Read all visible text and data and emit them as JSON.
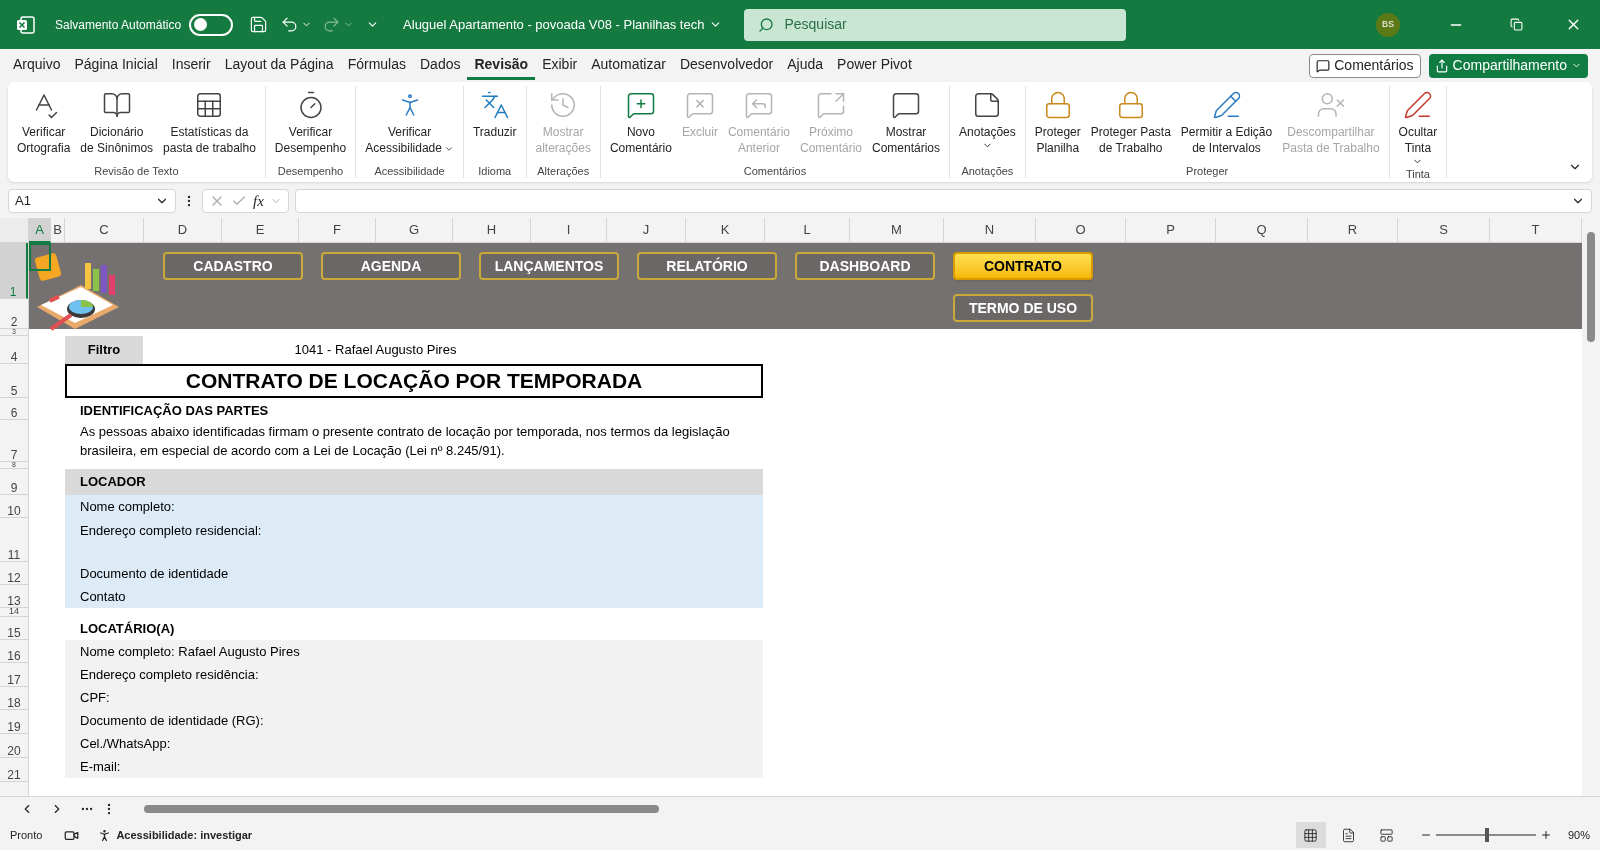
{
  "title_bar": {
    "autosave_label": "Salvamento Automático",
    "autosave_on": false,
    "document_title": "Aluguel Apartamento - povoada V08 - Planilhas tech",
    "search_placeholder": "Pesquisar",
    "user_initials": "BS"
  },
  "menu_tabs": [
    {
      "label": "Arquivo",
      "selected": false
    },
    {
      "label": "Página Inicial",
      "selected": false
    },
    {
      "label": "Inserir",
      "selected": false
    },
    {
      "label": "Layout da Página",
      "selected": false
    },
    {
      "label": "Fórmulas",
      "selected": false
    },
    {
      "label": "Dados",
      "selected": false
    },
    {
      "label": "Revisão",
      "selected": true
    },
    {
      "label": "Exibir",
      "selected": false
    },
    {
      "label": "Automatizar",
      "selected": false
    },
    {
      "label": "Desenvolvedor",
      "selected": false
    },
    {
      "label": "Ajuda",
      "selected": false
    },
    {
      "label": "Power Pivot",
      "selected": false
    }
  ],
  "comments_button": "Comentários",
  "share_button": "Compartilhamento",
  "ribbon_groups": [
    {
      "label": "Revisão de Texto",
      "commands": [
        {
          "label": "Verificar\nOrtografia",
          "disabled": false,
          "dropdown": false
        },
        {
          "label": "Dicionário\nde Sinônimos",
          "disabled": false,
          "dropdown": false
        },
        {
          "label": "Estatísticas da\npasta de trabalho",
          "disabled": false,
          "dropdown": false
        }
      ]
    },
    {
      "label": "Desempenho",
      "commands": [
        {
          "label": "Verificar\nDesempenho",
          "disabled": false,
          "dropdown": false
        }
      ]
    },
    {
      "label": "Acessibilidade",
      "commands": [
        {
          "label": "Verificar\nAcessibilidade",
          "disabled": false,
          "dropdown": true
        }
      ]
    },
    {
      "label": "Idioma",
      "commands": [
        {
          "label": "Traduzir",
          "disabled": false,
          "dropdown": false
        }
      ]
    },
    {
      "label": "Alterações",
      "commands": [
        {
          "label": "Mostrar\nalterações",
          "disabled": true,
          "dropdown": false
        }
      ]
    },
    {
      "label": "Comentários",
      "commands": [
        {
          "label": "Novo\nComentário",
          "disabled": false,
          "dropdown": false
        },
        {
          "label": "Excluir",
          "disabled": true,
          "dropdown": false
        },
        {
          "label": "Comentário\nAnterior",
          "disabled": true,
          "dropdown": false
        },
        {
          "label": "Próximo\nComentário",
          "disabled": true,
          "dropdown": false
        },
        {
          "label": "Mostrar\nComentários",
          "disabled": false,
          "dropdown": false
        }
      ]
    },
    {
      "label": "Anotações",
      "commands": [
        {
          "label": "Anotações",
          "disabled": false,
          "dropdown": true
        }
      ]
    },
    {
      "label": "Proteger",
      "commands": [
        {
          "label": "Proteger\nPlanilha",
          "disabled": false,
          "dropdown": false
        },
        {
          "label": "Proteger Pasta\nde Trabalho",
          "disabled": false,
          "dropdown": false
        },
        {
          "label": "Permitir a Edição\nde Intervalos",
          "disabled": false,
          "dropdown": false
        },
        {
          "label": "Descompartilhar\nPasta de Trabalho",
          "disabled": true,
          "dropdown": false
        }
      ]
    },
    {
      "label": "Tinta",
      "commands": [
        {
          "label": "Ocultar\nTinta",
          "disabled": false,
          "dropdown": true
        }
      ]
    }
  ],
  "formula_bar": {
    "name_box": "A1",
    "function_symbol": "fx"
  },
  "columns": [
    {
      "label": "A",
      "selected": true
    },
    {
      "label": "B",
      "selected": false
    },
    {
      "label": "C",
      "selected": false
    },
    {
      "label": "D",
      "selected": false
    },
    {
      "label": "E",
      "selected": false
    },
    {
      "label": "F",
      "selected": false
    },
    {
      "label": "G",
      "selected": false
    },
    {
      "label": "H",
      "selected": false
    },
    {
      "label": "I",
      "selected": false
    },
    {
      "label": "J",
      "selected": false
    },
    {
      "label": "K",
      "selected": false
    },
    {
      "label": "L",
      "selected": false
    },
    {
      "label": "M",
      "selected": false
    },
    {
      "label": "N",
      "selected": false
    },
    {
      "label": "O",
      "selected": false
    },
    {
      "label": "P",
      "selected": false
    },
    {
      "label": "Q",
      "selected": false
    },
    {
      "label": "R",
      "selected": false
    },
    {
      "label": "S",
      "selected": false
    },
    {
      "label": "T",
      "selected": false
    }
  ],
  "rows": [
    {
      "label": "1",
      "selected": true
    },
    {
      "label": "2",
      "selected": false
    },
    {
      "label": "3",
      "selected": false
    },
    {
      "label": "4",
      "selected": false
    },
    {
      "label": "5",
      "selected": false
    },
    {
      "label": "6",
      "selected": false
    },
    {
      "label": "7",
      "selected": false
    },
    {
      "label": "8",
      "selected": false
    },
    {
      "label": "9",
      "selected": false
    },
    {
      "label": "10",
      "selected": false
    },
    {
      "label": "11",
      "selected": false
    },
    {
      "label": "12",
      "selected": false
    },
    {
      "label": "13",
      "selected": false
    },
    {
      "label": "14",
      "selected": false
    },
    {
      "label": "15",
      "selected": false
    },
    {
      "label": "16",
      "selected": false
    },
    {
      "label": "17",
      "selected": false
    },
    {
      "label": "18",
      "selected": false
    },
    {
      "label": "19",
      "selected": false
    },
    {
      "label": "20",
      "selected": false
    },
    {
      "label": "21",
      "selected": false
    }
  ],
  "nav_buttons": [
    {
      "label": "CADASTRO",
      "selected": false
    },
    {
      "label": "AGENDA",
      "selected": false
    },
    {
      "label": "LANÇAMENTOS",
      "selected": false
    },
    {
      "label": "RELATÓRIO",
      "selected": false
    },
    {
      "label": "DASHBOARD",
      "selected": false
    },
    {
      "label": "CONTRATO",
      "selected": true
    },
    {
      "label": "TERMO DE USO",
      "selected": false
    }
  ],
  "contract": {
    "filter_label": "Filtro",
    "filter_value": "1041 - Rafael Augusto Pires",
    "title": "CONTRATO DE LOCAÇÃO POR TEMPORADA",
    "intro_heading": "IDENTIFICAÇÃO DAS PARTES",
    "intro_text": "As pessoas abaixo identificadas firmam o presente contrato de locação por temporada, nos termos da legislação brasileira, em especial de acordo com a Lei de Locação (Lei nº 8.245/91).",
    "sections": [
      {
        "heading": "LOCADOR",
        "heading_shaded": true,
        "lines": [
          {
            "text": "Nome completo:",
            "tall": false
          },
          {
            "text": "Endereço completo residencial:",
            "tall": true
          },
          {
            "text": "Documento de identidade",
            "tall": false
          },
          {
            "text": "Contato",
            "tall": false
          }
        ]
      },
      {
        "heading": "LOCATÁRIO(A)",
        "heading_shaded": false,
        "lines": [
          {
            "text": "Nome completo: Rafael Augusto Pires",
            "tall": false
          },
          {
            "text": "Endereço completo residência:",
            "tall": false
          },
          {
            "text": "CPF:",
            "tall": false
          },
          {
            "text": "Documento de identidade (RG):",
            "tall": false
          },
          {
            "text": "Cel./WhatsApp:",
            "tall": false
          },
          {
            "text": "E-mail:",
            "tall": false
          }
        ]
      }
    ]
  },
  "status_bar": {
    "ready": "Pronto",
    "accessibility": "Acessibilidade: investigar",
    "views": [
      {
        "kind": "normal",
        "selected": true
      },
      {
        "kind": "page-layout",
        "selected": false
      },
      {
        "kind": "page-break",
        "selected": false
      }
    ],
    "zoom": {
      "level": 0.51,
      "reading": "90%"
    }
  }
}
